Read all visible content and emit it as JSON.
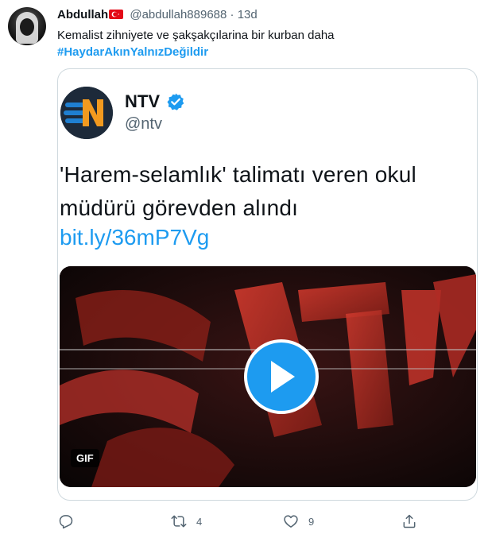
{
  "tweet": {
    "display_name": "Abdullah",
    "flag_icon": "turkey-flag-icon",
    "handle": "@abdullah889688",
    "separator": "·",
    "time": "13d",
    "text": "Kemalist zihniyete ve şakşakçılarina bir kurban daha",
    "hashtag": "#HaydarAkınYalnızDeğildir"
  },
  "quoted": {
    "name": "NTV",
    "handle": "@ntv",
    "verified_icon": "verified-badge-icon",
    "text": "'Harem-selamlık' talimatı veren okul müdürü görevden alındı",
    "link": "bit.ly/36mP7Vg",
    "media": {
      "badge": "GIF",
      "play_icon": "play-icon"
    }
  },
  "actions": {
    "reply_icon": "reply-icon",
    "retweet_icon": "retweet-icon",
    "retweet_count": "4",
    "like_icon": "heart-icon",
    "like_count": "9",
    "share_icon": "share-icon"
  },
  "colors": {
    "accent": "#1d9bf0",
    "text_primary": "#0f1419",
    "text_secondary": "#536471",
    "border": "#cfd9de",
    "flag_red": "#e30a17",
    "ntv_orange": "#f29a1f",
    "ntv_blue": "#1f7fd0"
  }
}
